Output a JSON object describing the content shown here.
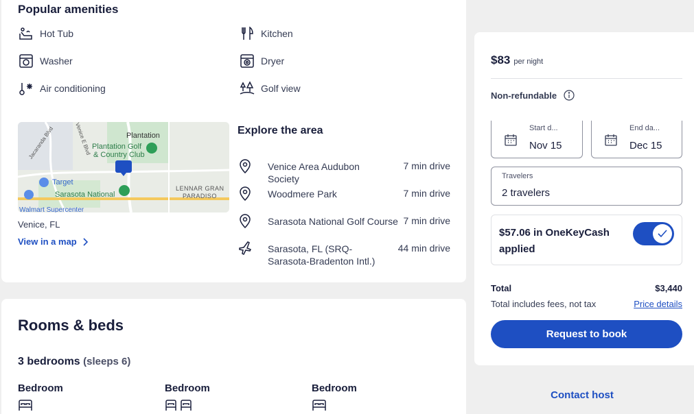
{
  "amenities": {
    "title": "Popular amenities",
    "items": [
      {
        "label": "Hot Tub",
        "icon": "hot-tub-icon"
      },
      {
        "label": "Kitchen",
        "icon": "kitchen-icon"
      },
      {
        "label": "Washer",
        "icon": "washer-icon"
      },
      {
        "label": "Dryer",
        "icon": "dryer-icon"
      },
      {
        "label": "Air conditioning",
        "icon": "air-conditioning-icon"
      },
      {
        "label": "Golf view",
        "icon": "golf-view-icon"
      }
    ]
  },
  "map": {
    "labels": {
      "plantation": "Plantation",
      "club_line1": "Plantation Golf",
      "club_line2": "& Country Club",
      "target": "Target",
      "sarasota_national": "Sarasota National",
      "lennar1": "LENNAR GRAN",
      "lennar2": "PARADISO",
      "walmart": "Walmart Supercenter",
      "road1": "Jacaranda Blvd",
      "road2": "Venice E Blvd"
    },
    "location": "Venice, FL",
    "view_link": "View in a map"
  },
  "explore": {
    "title": "Explore the area",
    "places": [
      {
        "name": "Venice Area Audubon Society",
        "distance": "7 min drive",
        "icon": "location-pin-icon"
      },
      {
        "name": "Woodmere Park",
        "distance": "7 min drive",
        "icon": "location-pin-icon"
      },
      {
        "name": "Sarasota National Golf Course",
        "distance": "7 min drive",
        "icon": "location-pin-icon"
      },
      {
        "name": "Sarasota, FL (SRQ-Sarasota-Bradenton Intl.)",
        "distance": "44 min drive",
        "icon": "airplane-icon"
      }
    ]
  },
  "rooms": {
    "title": "Rooms & beds",
    "subtitle": "3 bedrooms",
    "sleeps": "(sleeps 6)",
    "bedrooms": [
      {
        "label": "Bedroom",
        "beds": 1
      },
      {
        "label": "Bedroom",
        "beds": 2
      },
      {
        "label": "Bedroom",
        "beds": 1
      }
    ]
  },
  "booking": {
    "price": "$83",
    "per_night": "per night",
    "refund": "Non-refundable",
    "start_label": "Start d...",
    "start_value": "Nov 15",
    "end_label": "End da...",
    "end_value": "Dec 15",
    "travelers_label": "Travelers",
    "travelers_value": "2 travelers",
    "onekey_text": "$57.06 in OneKeyCash applied",
    "onekey_on": true,
    "total_label": "Total",
    "total_value": "$3,440",
    "fees_note": "Total includes fees, not tax",
    "price_details": "Price details",
    "book_button": "Request to book",
    "contact_host": "Contact host"
  },
  "colors": {
    "accent": "#1e4fc2",
    "text": "#191e3b",
    "page_bg": "#efefef"
  }
}
